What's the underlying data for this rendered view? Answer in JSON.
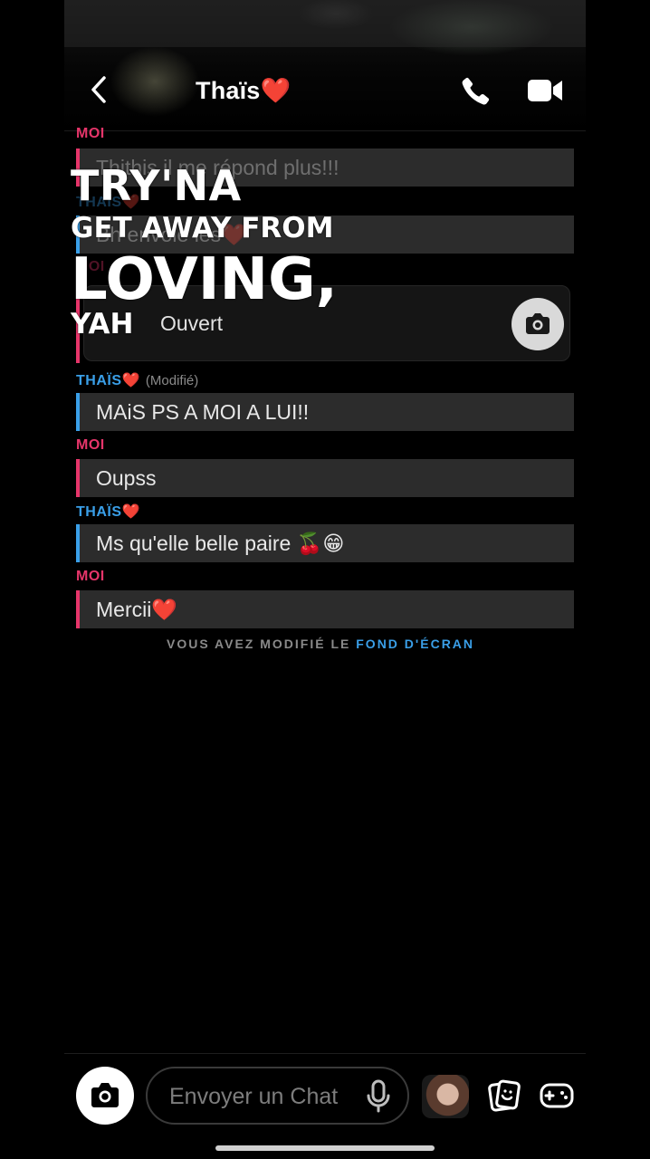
{
  "header": {
    "title": "Thaïs❤️"
  },
  "messages": [
    {
      "sender": "MOI",
      "text": "Thithis il me répond plus!!!"
    },
    {
      "sender": "THAÏS❤️",
      "text": "Bh envoie les❤️"
    },
    {
      "sender": "MOI",
      "type": "snap",
      "status": "Ouvert"
    },
    {
      "sender": "THAÏS❤️",
      "modified": "(Modifié)",
      "text": "MAiS PS A MOI A LUI!!"
    },
    {
      "sender": "MOI",
      "text": "Oupss"
    },
    {
      "sender": "THAÏS❤️",
      "text": "Ms qu'elle belle paire 🍒😁"
    },
    {
      "sender": "MOI",
      "text": "Mercii❤️"
    }
  ],
  "notice": {
    "prefix": "VOUS AVEZ MODIFIÉ LE",
    "link": "FOND D'ÉCRAN"
  },
  "lyrics": {
    "line1": "TRY'NA",
    "line2": "GET AWAY FROM",
    "line3": "LOVING,",
    "line4": "YAH"
  },
  "composer": {
    "placeholder": "Envoyer un Chat"
  },
  "icons": {
    "back": "chevron-left-icon",
    "call": "phone-icon",
    "video": "video-camera-icon",
    "camera": "camera-icon",
    "mic": "microphone-icon",
    "stickers": "sticker-icon",
    "games": "gamepad-icon"
  },
  "colors": {
    "me_accent": "#e6356a",
    "friend_accent": "#3a9fe8",
    "bubble": "#2c2c2c",
    "background": "#000000"
  }
}
